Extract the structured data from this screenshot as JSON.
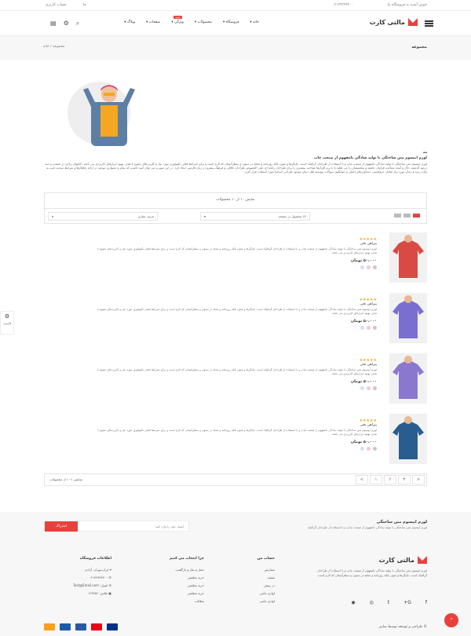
{
  "topbar": {
    "welcome": "خوش آمدید به فروشگاه ما",
    "phone": "۰۲۱۳۴۳۴۴۳۰۰",
    "account": "حساب کاربری",
    "lang": "فا"
  },
  "header": {
    "logo": "مالتی کارت",
    "nav": [
      {
        "label": "خانه"
      },
      {
        "label": "فروشگاه"
      },
      {
        "label": "محصولات"
      },
      {
        "label": "ویژگی",
        "badge": "جدید"
      },
      {
        "label": "صفحات"
      },
      {
        "label": "وبلاگ"
      }
    ]
  },
  "crumbs": {
    "title": "مجموعه",
    "home": "خانه",
    "sep": "/",
    "current": "مجموعه"
  },
  "category": {
    "heading": "مد",
    "subheading": "لورم ایپسوم متن ساختگی با تولید سادگی نامفهوم از صنعت چاپ",
    "text": "لورم ایپسوم متن ساختگی با تولید سادگی نامفهوم از صنعت چاپ و با استفاده از طراحان گرافیک است. چاپگرها و متون بلکه روزنامه و مجله در ستون و سطرآنچنان که لازم است و برای شرایط فعلی تکنولوژی مورد نیاز و کاربردهای متنوع با هدف بهبود ابزارهای کاربردی می باشد. کتابهای زیادی در شصت و سه درصد گذشته، حال و آینده شناخت فراوان جامعه و متخصصان را می طلبد تا با نرم افزارها شناخت بیشتری را برای طراحان رایانه ای علی الخصوص طراحان خلاقی و فرهنگ پیشرو در زبان فارسی ایجاد کرد. در این صورت می توان امید داشت که تمام و دشواری موجود در ارائه راهکارها و شرایط سخت تایپ به پایان رسد و زمان مورد نیاز شامل حروفچینی دستاوردهای اصلی و جوابگوی سوالات پیوسته اهل دنیای موجود طراحی اساسا مورد استفاده قرار گیرد."
  },
  "toolbar": {
    "count": "نمایش ۱۰ از ۱۰ محصولات",
    "per_page": "۲۴ محصول در صفحه",
    "sort": "مرتب سازی"
  },
  "products": [
    {
      "name": "پیراهن نخی",
      "rating": "★★★★★",
      "desc": "لورم ایپسوم متن ساختگی با تولید سادگی نامفهوم از صنعت چاپ و با استفاده از طراحان گرافیک است. چاپگرها و متون بلکه روزنامه و مجله در ستون و سطرآنچنان که لازم است و برای شرایط فعلی تکنولوژی مورد نیاز و کاربردهای متنوع با هدف بهبود ابزارهای کاربردی می باشد.",
      "price": "۵۰،۰۰۰ تومان",
      "swatches": [
        "#c8c8c8",
        "#f2c9d4",
        "#cfe3f5"
      ],
      "shirt": "#d94a45"
    },
    {
      "name": "پیراهن نخی",
      "rating": "★★★★★",
      "desc": "لورم ایپسوم متن ساختگی با تولید سادگی نامفهوم از صنعت چاپ و با استفاده از طراحان گرافیک است. چاپگرها و متون بلکه روزنامه و مجله در ستون و سطرآنچنان که لازم است و برای شرایط فعلی تکنولوژی مورد نیاز و کاربردهای متنوع با هدف بهبود ابزارهای کاربردی می باشد.",
      "price": "۵۰،۰۰۰ تومان",
      "swatches": [
        "#c8c8c8",
        "#f2c9d4",
        "#cfe3f5"
      ],
      "shirt": "#7a6fd0"
    },
    {
      "name": "پیراهن نخی",
      "rating": "★★★★★",
      "desc": "لورم ایپسوم متن ساختگی با تولید سادگی نامفهوم از صنعت چاپ و با استفاده از طراحان گرافیک است. چاپگرها و متون بلکه روزنامه و مجله در ستون و سطرآنچنان که لازم است و برای شرایط فعلی تکنولوژی مورد نیاز و کاربردهای متنوع با هدف بهبود ابزارهای کاربردی می باشد.",
      "price": "۵۰،۰۰۰ تومان",
      "swatches": [
        "#c8c8c8",
        "#f2c9d4",
        "#cfe3f5"
      ],
      "shirt": "#8a78cf"
    },
    {
      "name": "پیراهن نخی",
      "rating": "★★★★★",
      "desc": "لورم ایپسوم متن ساختگی با تولید سادگی نامفهوم از صنعت چاپ و با استفاده از طراحان گرافیک است. چاپگرها و متون بلکه روزنامه و مجله در ستون و سطرآنچنان که لازم است و برای شرایط فعلی تکنولوژی مورد نیاز و کاربردهای متنوع با هدف بهبود ابزارهای کاربردی می باشد.",
      "price": "۵۰،۰۰۰ تومان",
      "swatches": [
        "#c8c8c8",
        "#f2c9d4",
        "#cfe3f5"
      ],
      "shirt": "#2a5d8f"
    }
  ],
  "pager": {
    "info": "نمایش ۱-۱۰ از محصولات",
    "pages": [
      "<",
      "۱",
      "۲",
      "۳",
      ">"
    ],
    "current": 2
  },
  "footer": {
    "news_title": "لورم ایپسوم متن ساختگی",
    "news_sub": "لورم ایپسوم متن ساختگی با تولید سادگی نامفهوم از صنعت چاپ و با استفاده از طراحان گرافیک",
    "news_placeholder": "ایمیل خود را وارد کنید",
    "news_button": "اشتراک",
    "logo": "مالتی کارت",
    "desc": "لورم ایپسوم متن ساختگی با تولید سادگی نامفهوم از صنعت چاپ و با استفاده از طراحان گرافیک است. چاپگرها و متون بلکه روزنامه و مجله در ستون و سطرآنچنان که لازم است.",
    "col1": {
      "title": "حساب من",
      "items": [
        "سفارش",
        "نقشه",
        "در روش",
        "لوازم جانبی",
        "لوازم جانبی"
      ]
    },
    "col2": {
      "title": "چرا انتخاب می کنیم",
      "items": [
        "حمل و نقل و بازگشت",
        "خرید مطمئن",
        "خرید مطمئن",
        "خرید مطمئن",
        "مطالب"
      ]
    },
    "col3": {
      "title": "اطلاعات فروشگاه",
      "items": [
        "ایران،تهران، آزادی",
        "۰۲۱۳۴۳۴۴۳۰۰",
        "ایمیل: Test@Email.com",
        "فکس: ۱۲۳۴۵۶"
      ]
    },
    "copyright": "© طراحی و توسعه توسط سایبر",
    "social_icons": [
      "facebook-icon",
      "google-plus-icon",
      "twitter-icon",
      "instagram-icon",
      "rss-icon"
    ],
    "pay_colors": [
      "#f9a01b",
      "#1a5aa6",
      "#2b59a0",
      "#eb001b",
      "#003087"
    ]
  },
  "side": {
    "label": "فارسی"
  },
  "colors": {
    "accent": "#e8413c"
  }
}
